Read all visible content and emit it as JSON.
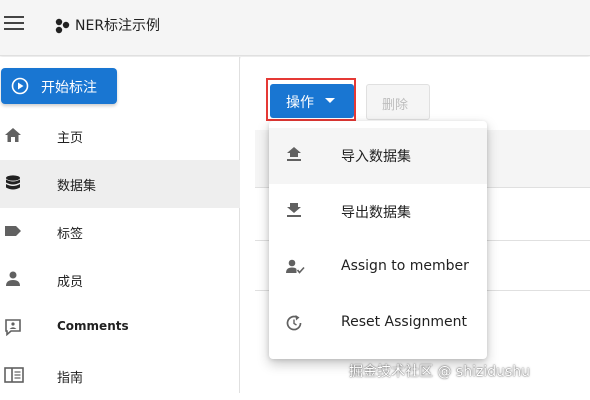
{
  "appbar": {
    "title": "NER标注示例"
  },
  "sidebar": {
    "start_button": "开始标注",
    "items": [
      {
        "label": "主页",
        "icon": "home-icon"
      },
      {
        "label": "数据集",
        "icon": "database-icon",
        "active": true
      },
      {
        "label": "标签",
        "icon": "label-icon"
      },
      {
        "label": "成员",
        "icon": "person-icon"
      },
      {
        "label": "Comments",
        "icon": "comment-icon"
      },
      {
        "label": "指南",
        "icon": "book-icon"
      }
    ]
  },
  "toolbar": {
    "action_label": "操作",
    "delete_label": "删除"
  },
  "menu": {
    "items": [
      {
        "label": "导入数据集",
        "icon": "upload-icon"
      },
      {
        "label": "导出数据集",
        "icon": "download-icon"
      },
      {
        "label": "Assign to member",
        "icon": "person-check-icon"
      },
      {
        "label": "Reset Assignment",
        "icon": "reset-icon"
      }
    ]
  },
  "watermark": "掘金技术社区 @ shizidushu",
  "colors": {
    "primary": "#1976d2",
    "highlight": "#e53935"
  }
}
